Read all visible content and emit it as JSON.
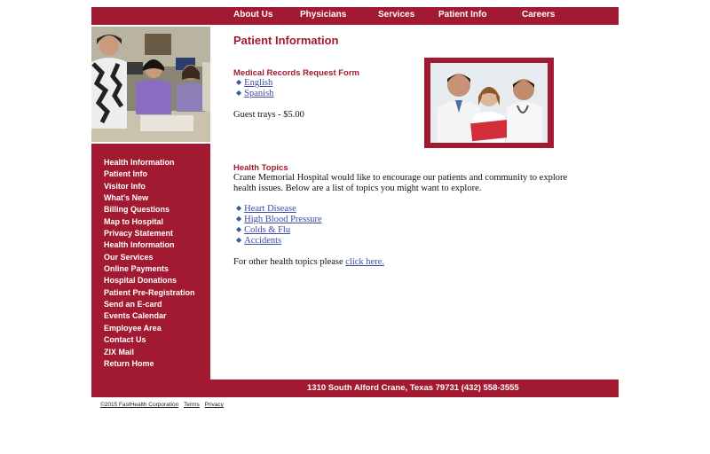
{
  "topnav": {
    "items": [
      {
        "label": "About Us"
      },
      {
        "label": "Physicians"
      },
      {
        "label": "Services"
      },
      {
        "label": "Patient Info"
      },
      {
        "label": "Careers"
      }
    ]
  },
  "sidebar": {
    "items": [
      {
        "label": "Health Information"
      },
      {
        "label": "Patient Info"
      },
      {
        "label": "Visitor Info"
      },
      {
        "label": "What's New"
      },
      {
        "label": "Billing Questions"
      },
      {
        "label": "Map to Hospital"
      },
      {
        "label": "Privacy Statement"
      },
      {
        "label": "Health Information"
      },
      {
        "label": "Our Services"
      },
      {
        "label": "Online Payments"
      },
      {
        "label": "Hospital Donations"
      },
      {
        "label": "Patient Pre-Registration"
      },
      {
        "label": "Send an E-card"
      },
      {
        "label": "Events Calendar"
      },
      {
        "label": "Employee Area"
      },
      {
        "label": "Contact Us"
      },
      {
        "label": "ZIX Mail"
      },
      {
        "label": "Return Home"
      }
    ]
  },
  "main": {
    "title": "Patient Information",
    "records": {
      "heading": "Medical Records Request Form",
      "links": [
        {
          "label": "English"
        },
        {
          "label": "Spanish"
        }
      ]
    },
    "guest_trays": "Guest trays - $5.00",
    "health_topics": {
      "heading": "Health Topics",
      "intro": "Crane Memorial Hospital would like to encourage our patients and community to explore health issues. Below are a list of topics you might want to explore.",
      "links": [
        {
          "label": "Heart Disease"
        },
        {
          "label": "High Blood Pressure"
        },
        {
          "label": "Colds & Flu"
        },
        {
          "label": "Accidents"
        }
      ],
      "other_prefix": "For other health topics please ",
      "other_link": "click here."
    }
  },
  "footer": {
    "address": "1310 South Alford Crane, Texas 79731 (432) 558-3555",
    "copyright": "©2015 FastHealth Corporation",
    "terms_label": "Terms",
    "privacy_label": "Privacy"
  },
  "colors": {
    "brand": "#a21a32",
    "link": "#3b4ba0"
  },
  "icons": {
    "bullet": "diamond-bullet-icon"
  }
}
